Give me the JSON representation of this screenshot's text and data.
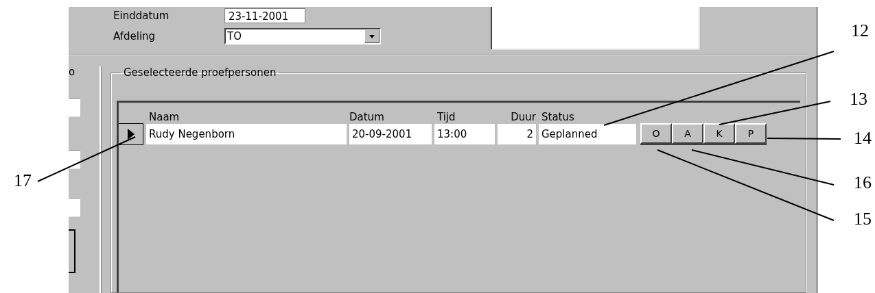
{
  "form": {
    "fields": [
      {
        "label": "Einddatum",
        "value": "23-11-2001",
        "kind": "date"
      },
      {
        "label": "Afdeling",
        "value": "TO",
        "kind": "combo"
      }
    ]
  },
  "left_group": {
    "label": "o"
  },
  "group": {
    "title": "Geselecteerde proefpersonen",
    "columns": [
      "Naam",
      "Datum",
      "Tijd",
      "Duur",
      "Status"
    ],
    "rows": [
      {
        "selected": true,
        "cells": [
          "Rudy Negenborn",
          "20-09-2001",
          "13:00",
          "2",
          "Geplanned"
        ],
        "buttons": [
          "O",
          "A",
          "K",
          "P"
        ]
      }
    ]
  },
  "callouts": [
    {
      "number": "12"
    },
    {
      "number": "13"
    },
    {
      "number": "14"
    },
    {
      "number": "17"
    },
    {
      "number": "16"
    },
    {
      "number": "15"
    }
  ]
}
